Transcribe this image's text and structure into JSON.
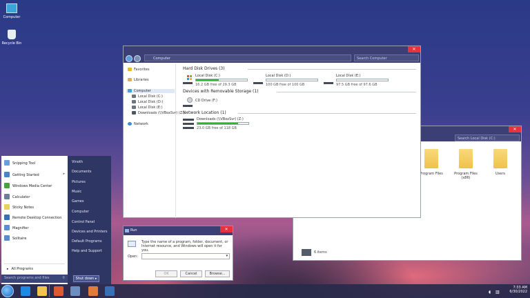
{
  "desktop": {
    "icons": [
      {
        "label": "Computer",
        "icon": "computer-icon"
      },
      {
        "label": "Recycle Bin",
        "icon": "recycle-bin-icon"
      }
    ]
  },
  "explorer": {
    "address": "Computer",
    "search_placeholder": "Search Computer",
    "close_label": "✕",
    "nav": [
      {
        "label": "Favorites",
        "icon": "star-icon"
      },
      {
        "label": "Libraries",
        "icon": "library-icon"
      },
      {
        "label": "Computer",
        "icon": "computer-icon"
      },
      {
        "label": "Local Disk (C:)",
        "icon": "drive-icon"
      },
      {
        "label": "Local Disk (D:)",
        "icon": "drive-icon"
      },
      {
        "label": "Local Disk (E:)",
        "icon": "drive-icon"
      },
      {
        "label": "Downloads (\\\\VBoxSvr) (Z:)",
        "icon": "network-drive-icon"
      },
      {
        "label": "Network",
        "icon": "network-icon"
      }
    ],
    "groups": {
      "hdd": "Hard Disk Drives (3)",
      "removable": "Devices with Removable Storage (1)",
      "network": "Network Location (1)"
    },
    "drives": [
      {
        "name": "Local Disk (C:)",
        "free": "16.2 GB free of 29.3 GB",
        "used_fraction": 0.45
      },
      {
        "name": "Local Disk (D:)",
        "free": "100 GB free of 100 GB",
        "used_fraction": 0.0
      },
      {
        "name": "Local Disk (E:)",
        "free": "97.5 GB free of 97.6 GB",
        "used_fraction": 0.0
      }
    ],
    "cd": {
      "name": "CD Drive (F:)"
    },
    "netdrive": {
      "name": "Downloads (\\\\VBoxSvr) (Z:)",
      "free": "23.0 GB free of 118 GB",
      "used_fraction": 0.8
    }
  },
  "explorer2": {
    "search_placeholder": "Search Local Disk (C:)",
    "close_label": "✕",
    "folders": [
      "Program Files",
      "Program Files (x86)",
      "Users"
    ],
    "status": "6 items"
  },
  "start_menu": {
    "programs": [
      {
        "label": "Snipping Tool",
        "icon": "scissors-icon",
        "color": "#6a9fd8"
      },
      {
        "label": "Getting Started",
        "icon": "getting-started-icon",
        "color": "#4a84c4"
      },
      {
        "label": "Windows Media Center",
        "icon": "media-center-icon",
        "color": "#4aa043"
      },
      {
        "label": "Calculator",
        "icon": "calculator-icon",
        "color": "#6b7f96"
      },
      {
        "label": "Sticky Notes",
        "icon": "sticky-notes-icon",
        "color": "#e8d35a"
      },
      {
        "label": "Remote Desktop Connection",
        "icon": "remote-desktop-icon",
        "color": "#3a6fb5"
      },
      {
        "label": "Magnifier",
        "icon": "magnifier-icon",
        "color": "#5c8fca"
      },
      {
        "label": "Solitaire",
        "icon": "cards-icon",
        "color": "#5b8cc9"
      }
    ],
    "all_programs": "All Programs",
    "search_placeholder": "Search programs and files",
    "right_items": [
      "Vinoth",
      "Documents",
      "Pictures",
      "Music",
      "Games",
      "Computer",
      "Control Panel",
      "Devices and Printers",
      "Default Programs",
      "Help and Support"
    ],
    "shutdown_label": "Shut down"
  },
  "run_dialog": {
    "title": "Run",
    "description": "Type the name of a program, folder, document, or Internet resource, and Windows will open it for you.",
    "open_label": "Open:",
    "ok": "OK",
    "cancel": "Cancel",
    "browse": "Browse..."
  },
  "taskbar": {
    "time": "7:33 AM",
    "date": "6/30/2022"
  }
}
